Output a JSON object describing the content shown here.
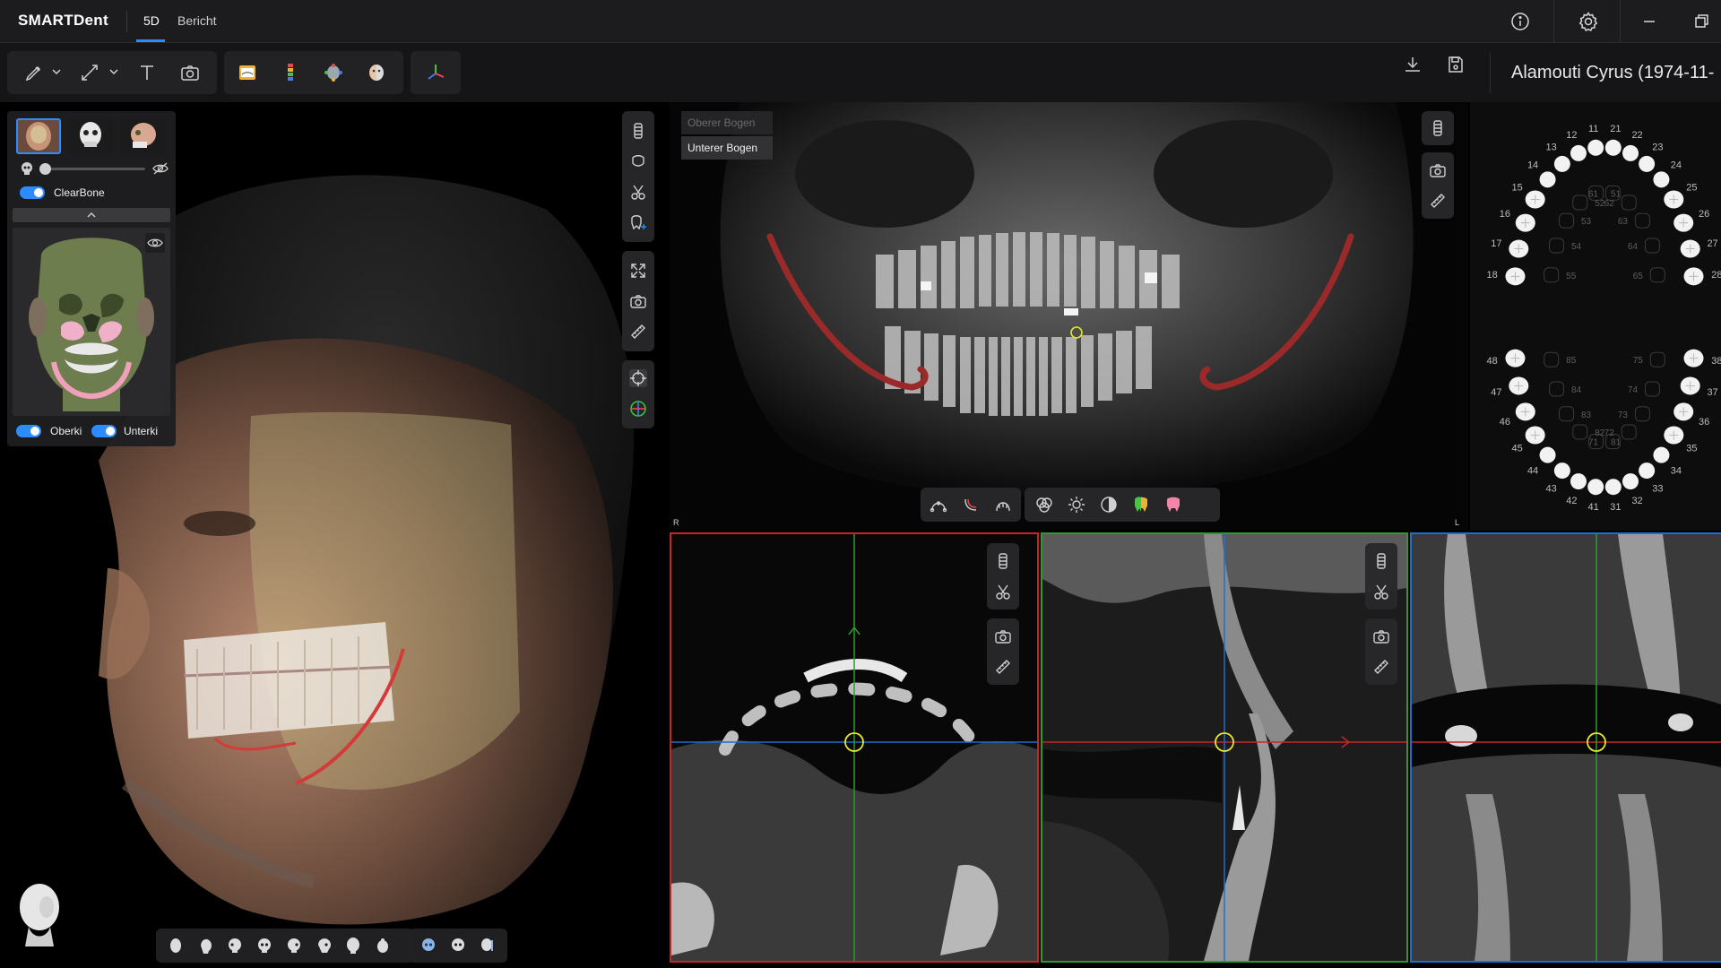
{
  "app": {
    "logo": "SMARTDent"
  },
  "tabs": [
    {
      "label": "5D",
      "active": true
    },
    {
      "label": "Bericht",
      "active": false
    }
  ],
  "patient": {
    "name": "Alamouti Cyrus (1974-11-"
  },
  "visibility_panel": {
    "clearbone_label": "ClearBone",
    "upper_jaw_label": "Oberkie",
    "lower_jaw_label": "Unterki",
    "clearbone_on": true,
    "upper_jaw_on": true,
    "lower_jaw_on": true
  },
  "panorama": {
    "arch_upper": "Oberer Bogen",
    "arch_lower": "Unterer Bogen",
    "side_right": "R",
    "side_left": "L"
  },
  "tooth_chart": {
    "permanent": [
      "11",
      "12",
      "13",
      "14",
      "15",
      "16",
      "17",
      "18",
      "21",
      "22",
      "23",
      "24",
      "25",
      "26",
      "27",
      "28",
      "31",
      "32",
      "33",
      "34",
      "35",
      "36",
      "37",
      "38",
      "41",
      "42",
      "43",
      "44",
      "45",
      "46",
      "47",
      "48"
    ],
    "primary": [
      "51",
      "52",
      "53",
      "54",
      "55",
      "61",
      "62",
      "63",
      "64",
      "65",
      "71",
      "72",
      "73",
      "74",
      "75",
      "81",
      "82",
      "83",
      "84",
      "85"
    ]
  },
  "colors": {
    "accent": "#2d8cff",
    "axial_border": "#c62626",
    "sagittal_border": "#2e9a2e",
    "coronal_border": "#1f6fd1",
    "marker": "#e6e62e"
  },
  "icons": {
    "toolbar": [
      "pen-icon",
      "ruler-icon",
      "text-icon",
      "camera-icon",
      "panorama-icon",
      "color-scale-icon",
      "landmark-icon",
      "face-half-icon",
      "axes-icon"
    ],
    "top_right": [
      "info-icon",
      "gear-icon",
      "minimize-icon",
      "restore-icon"
    ]
  }
}
